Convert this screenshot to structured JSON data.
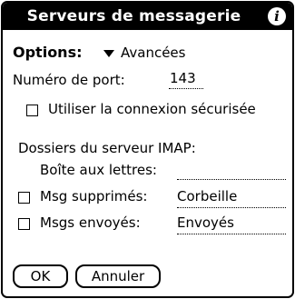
{
  "dialog": {
    "title": "Serveurs de messagerie",
    "info_icon": "info-icon"
  },
  "options": {
    "label": "Options:",
    "value": "Avancées"
  },
  "port": {
    "label": "Numéro de port:",
    "value": "143"
  },
  "secure_connection": {
    "label": "Utiliser la connexion sécurisée",
    "checked": false
  },
  "imap": {
    "heading": "Dossiers du serveur IMAP:",
    "inbox_label": "Boîte aux lettres:",
    "inbox_value": "",
    "deleted": {
      "label": "Msg supprimés:",
      "value": "Corbeille",
      "checked": false
    },
    "sent": {
      "label": "Msgs envoyés:",
      "value": "Envoyés",
      "checked": false
    }
  },
  "buttons": {
    "ok": "OK",
    "cancel": "Annuler"
  }
}
